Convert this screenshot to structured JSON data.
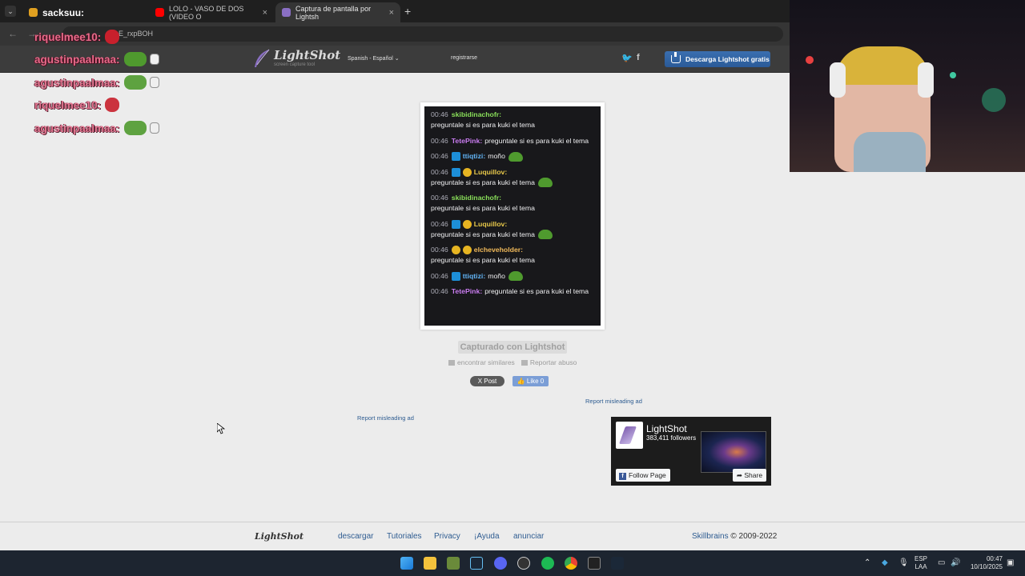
{
  "browser": {
    "tabs": [
      {
        "label": "sacksuu:",
        "favicon_color": "#e0a020"
      },
      {
        "label": "LOLO - VASO DE DOS (VIDEO O",
        "favicon_color": "#ff0000"
      },
      {
        "label": "Captura de pantalla por Lightsh",
        "favicon_color": "#8a6fc4",
        "active": true
      }
    ],
    "close_glyph": "×",
    "new_tab_glyph": "+",
    "url_fragment": "E_rxpBOH"
  },
  "header": {
    "logo_name": "LightShot",
    "logo_tagline": "screen capture tool",
    "language": "Spanish - Español",
    "register": "registrarse",
    "twitter_glyph": "🐦",
    "facebook_glyph": "f",
    "download_label": "Descarga Lightshot gratis"
  },
  "overlay_chat": [
    {
      "user": "riquelmee10:",
      "emote": "devil"
    },
    {
      "user": "agustinpaalmaa:",
      "emote": "frog"
    },
    {
      "user": "agustinpaalmaa:",
      "emote": "frog"
    },
    {
      "user": "riquelmee10:",
      "emote": "devil"
    },
    {
      "user": "agustinpaalmaa:",
      "emote": "frog"
    }
  ],
  "screenshot_chat": [
    {
      "time": "00:46",
      "user": "skibidinachofr:",
      "color": "#8ae05a",
      "text": "preguntale si es para kuki el tema",
      "badges": [],
      "emote": false
    },
    {
      "time": "00:46",
      "user": "TetePink:",
      "color": "#c97cf0",
      "text": "preguntale si es para kuki el tema",
      "badges": [],
      "emote": false
    },
    {
      "time": "00:46",
      "user": "ttiqtizi:",
      "color": "#62b4f5",
      "text": "moño",
      "badges": [
        "pin"
      ],
      "emote": true
    },
    {
      "time": "00:46",
      "user": "Luquillov:",
      "color": "#e8c94a",
      "text": "preguntale si es para kuki el tema",
      "badges": [
        "pin",
        "gold"
      ],
      "emote": true
    },
    {
      "time": "00:46",
      "user": "skibidinachofr:",
      "color": "#8ae05a",
      "text": "preguntale si es para kuki el tema",
      "badges": [],
      "emote": false
    },
    {
      "time": "00:46",
      "user": "Luquillov:",
      "color": "#e8c94a",
      "text": "preguntale si es para kuki el tema",
      "badges": [
        "pin",
        "gold"
      ],
      "emote": true
    },
    {
      "time": "00:46",
      "user": "elcheveholder:",
      "color": "#f0b95a",
      "text": "preguntale si es para kuki el tema",
      "badges": [
        "gold",
        "gold"
      ],
      "emote": false
    },
    {
      "time": "00:46",
      "user": "ttiqtizi:",
      "color": "#62b4f5",
      "text": "moño",
      "badges": [
        "pin"
      ],
      "emote": true
    },
    {
      "time": "00:46",
      "user": "TetePink:",
      "color": "#c97cf0",
      "text": "preguntale si es para kuki el tema",
      "badges": [],
      "emote": false
    }
  ],
  "page": {
    "captured": "Capturado con Lightshot",
    "find_similar": "encontrar similares",
    "report_abuse": "Reportar abuso",
    "post": "X Post",
    "like": "Like 0",
    "report_ad": "Report misleading ad"
  },
  "fb": {
    "name": "LightShot",
    "followers": "383,411 followers",
    "follow": "Follow Page",
    "share": "Share"
  },
  "footer": {
    "logo": "LightShot",
    "links": [
      "descargar",
      "Tutoriales",
      "Privacy",
      "¡Ayuda",
      "anunciar"
    ],
    "company": "Skillbrains",
    "copyright": "© 2009-2022"
  },
  "taskbar": {
    "lang1": "ESP",
    "lang2": "LAA",
    "time": "00:47",
    "date": "10/10/2025"
  }
}
